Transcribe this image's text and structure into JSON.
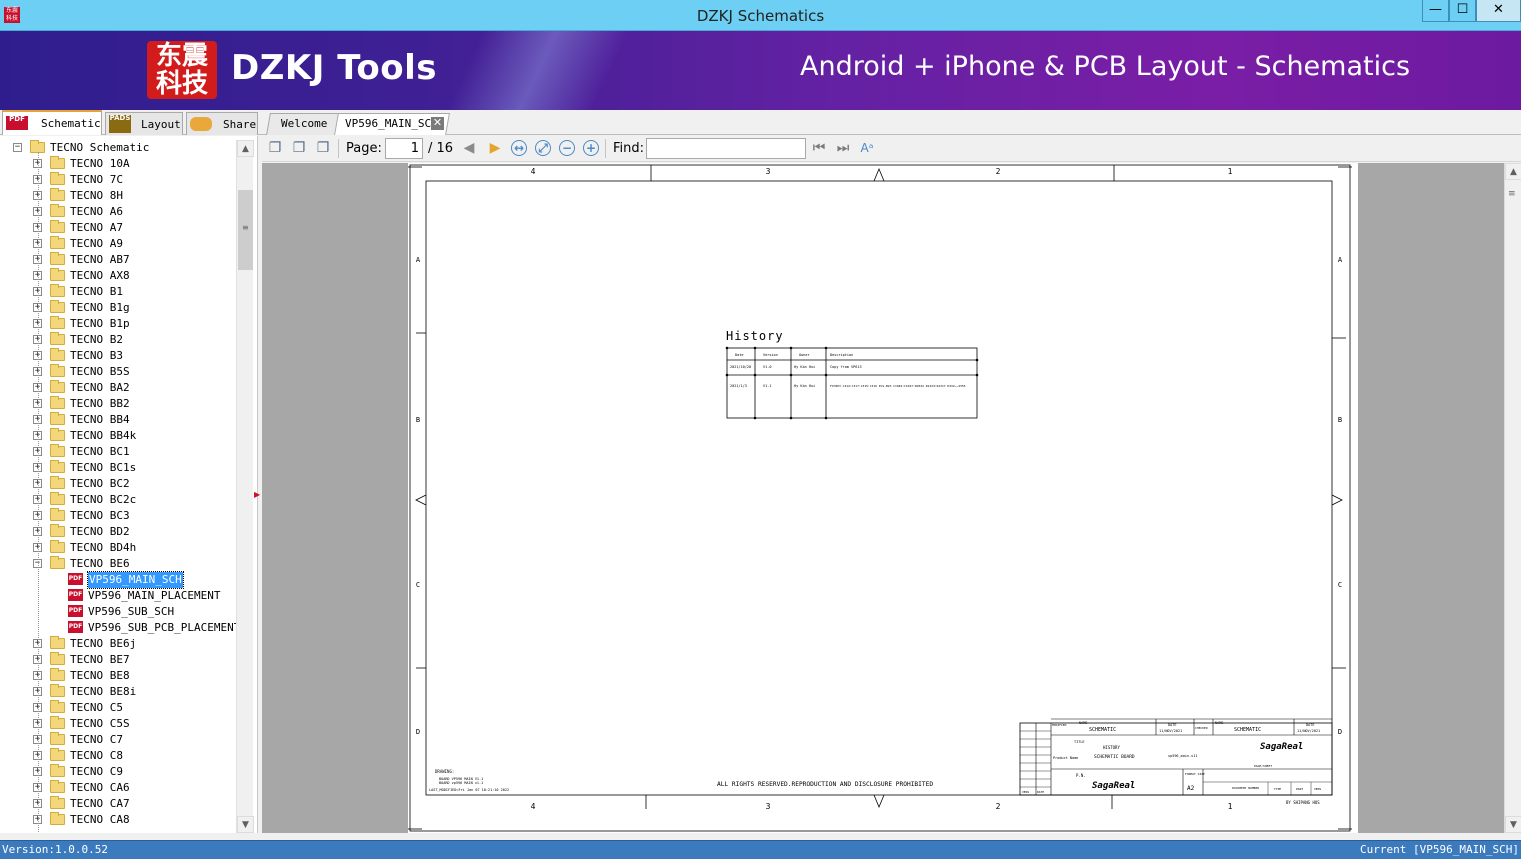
{
  "window": {
    "title": "DZKJ Schematics",
    "app_icon_text": "东震科技",
    "min_glyph": "—",
    "max_glyph": "☐",
    "close_glyph": "✕"
  },
  "banner": {
    "logo_text": "东震\n科技",
    "brand": "DZKJ Tools",
    "tagline": "Android + iPhone & PCB Layout - Schematics"
  },
  "left_tabs": [
    {
      "label": "Schematic",
      "icon_text": "PDF",
      "icon": "pdf-icon"
    },
    {
      "label": "Layout",
      "icon_text": "PADS",
      "icon": "pads-icon"
    },
    {
      "label": "Share",
      "icon_text": "",
      "icon": "cloud-share-icon"
    }
  ],
  "doc_tabs": {
    "welcome": "Welcome",
    "active": "VP596_MAIN_SCH",
    "close_glyph": "✕"
  },
  "tree": {
    "root": "TECNO Schematic",
    "items": [
      "TECNO 10A",
      "TECNO 7C",
      "TECNO 8H",
      "TECNO A6",
      "TECNO A7",
      "TECNO A9",
      "TECNO AB7",
      "TECNO AX8",
      "TECNO B1",
      "TECNO B1g",
      "TECNO B1p",
      "TECNO B2",
      "TECNO B3",
      "TECNO B5S",
      "TECNO BA2",
      "TECNO BB2",
      "TECNO BB4",
      "TECNO BB4k",
      "TECNO BC1",
      "TECNO BC1s",
      "TECNO BC2",
      "TECNO BC2c",
      "TECNO BC3",
      "TECNO BD2",
      "TECNO BD4h",
      "TECNO BE6"
    ],
    "expanded_children": [
      "VP596_MAIN_SCH",
      "VP596_MAIN_PLACEMENT",
      "VP596_SUB_SCH",
      "VP596_SUB_PCB_PLACEMENT"
    ],
    "selected": "VP596_MAIN_SCH",
    "items_after": [
      "TECNO BE6j",
      "TECNO BE7",
      "TECNO BE8",
      "TECNO BE8i",
      "TECNO C5",
      "TECNO C5S",
      "TECNO C7",
      "TECNO C8",
      "TECNO C9",
      "TECNO CA6",
      "TECNO CA7",
      "TECNO CA8"
    ],
    "expand_plus": "+",
    "expand_minus": "−",
    "pdf_icon_text": "PDF"
  },
  "toolbar": {
    "page_label": "Page:",
    "page_value": "1",
    "page_total": "/ 16",
    "find_label": "Find:",
    "find_value": "",
    "icons": [
      "copy-icon",
      "copy-multi-icon",
      "copy-page-icon",
      "prev-page-icon",
      "next-page-icon",
      "fit-width-icon",
      "fit-page-icon",
      "zoom-out-icon",
      "zoom-in-icon",
      "find-first-icon",
      "find-next-icon",
      "text-style-icon"
    ],
    "glyphs": {
      "prev": "◀",
      "next": "▶",
      "zoom_out": "−",
      "zoom_in": "+",
      "fit_width": "↔",
      "fit_page": "⤢",
      "find_first": "⏮",
      "find_next": "⏭",
      "text_style": "Aᵃ",
      "copy": "❐"
    }
  },
  "document": {
    "column_labels": [
      "4",
      "3",
      "2",
      "1"
    ],
    "row_labels": [
      "A",
      "B",
      "C",
      "D"
    ],
    "history_title": "History",
    "history_headers": [
      "Date",
      "Version",
      "Owner",
      "Description"
    ],
    "history_rows": [
      [
        "2021/10/20",
        "V1.0",
        "Hy Kim Hui",
        "Copy from VP613"
      ],
      [
        "2021/1/3",
        "V1.1",
        "Hy Kim Hui",
        "FCHIP3 C214:C317:C315:C316\nPLS-B23 C1049:C1047:R4542 R1234:R1317 D432~~4355"
      ]
    ],
    "drawing_label": "DRAWING:",
    "drawing_lines": [
      "BOARD VP596 MAIN V1.1",
      "BOARD vp596 MAIN v1.1"
    ],
    "last_modified": "LAST_MODIFIED=Fri Jan 07 10:21:10 2022",
    "rights_notice": "ALL RIGHTS RESERVED.REPRODUCTION AND DISCLOSURE PROHIBITED",
    "titleblock": {
      "modified": "MODIFIED",
      "name_label": "NAME",
      "name_value": "SCHEMATIC",
      "date_label": "DATE",
      "date_value": "11/NOV/2021",
      "checked": "CHECKED",
      "checked_name": "SCHEMATIC",
      "checked_date": "11/NOV/2021",
      "title_label": "TITLE",
      "title_value": "HISTORY",
      "product_label": "Product Name",
      "product_value": "SCHEMATIC BOARD",
      "file_value": "vp596_main.v11",
      "pn_label": "P.N.",
      "format_label": "FORMAT SIZE",
      "format_value": "A2",
      "doc_number": "DOCUMENT NUMBER",
      "page_sheet": "PAGE/SHEET",
      "type": "TYPE",
      "part": "PART",
      "vers": "VERS",
      "vers_label": "VERS",
      "date_small": "DATE",
      "company": "SagaReal",
      "footer": "BY SHIPANG HOS"
    }
  },
  "status": {
    "version": "Version:1.0.0.52",
    "current": "Current [VP596_MAIN_SCH]"
  },
  "colors": {
    "titlebar": "#6ccff3",
    "banner_start": "#2f1d8e",
    "banner_end": "#7a1ea6",
    "selection": "#3399ff",
    "statusbar": "#3b7abd",
    "pdf_red": "#c8102e"
  }
}
